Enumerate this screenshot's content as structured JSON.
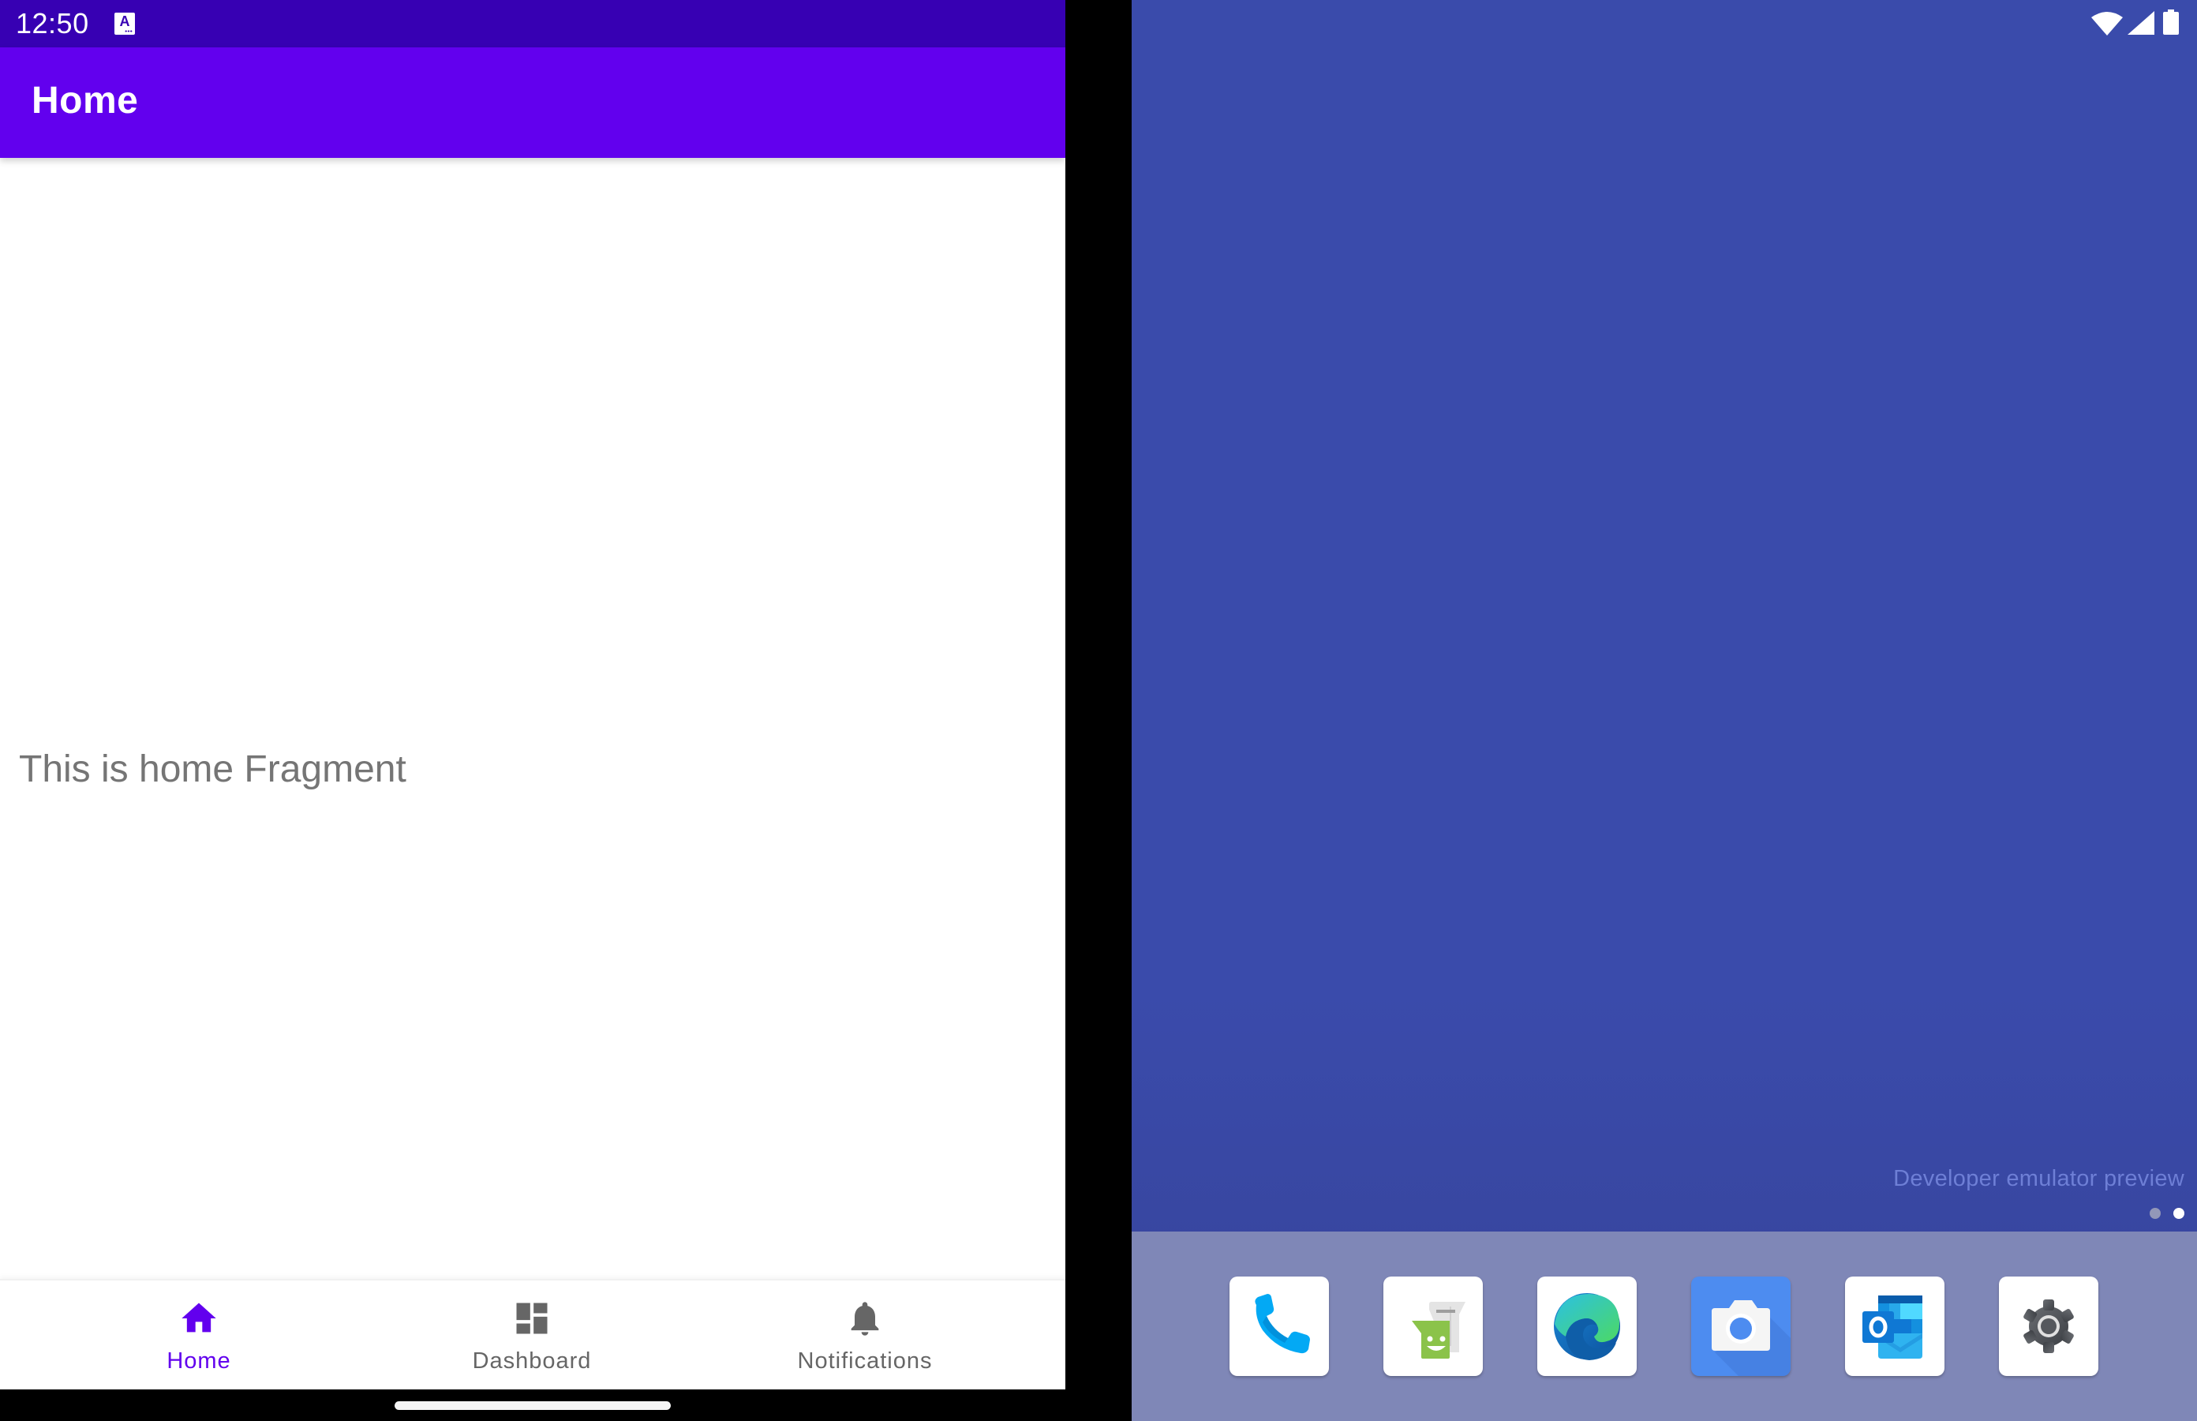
{
  "device": {
    "left_screen": {
      "status_bar": {
        "time": "12:50",
        "notification_icons": [
          "accessibility-a-icon"
        ],
        "color": "#3700b3"
      },
      "app_bar": {
        "title": "Home",
        "color": "#6200ee"
      },
      "content": {
        "text": "This is home Fragment",
        "text_color": "#757575"
      },
      "bottom_nav": {
        "active_color": "#6200ee",
        "inactive_color": "#666666",
        "items": [
          {
            "label": "Home",
            "icon": "home-icon",
            "active": true
          },
          {
            "label": "Dashboard",
            "icon": "dashboard-icon",
            "active": false
          },
          {
            "label": "Notifications",
            "icon": "bell-icon",
            "active": false
          }
        ]
      }
    },
    "right_screen": {
      "status_icons": [
        "wifi-icon",
        "cellular-signal-icon",
        "battery-icon"
      ],
      "wallpaper_color": "#3a4bab",
      "watermark": "Developer emulator preview",
      "page_indicator": {
        "pages": 2,
        "current": 2
      },
      "dock": {
        "color": "#7f87b7",
        "apps": [
          {
            "name": "Phone",
            "icon": "phone-icon"
          },
          {
            "name": "Messages",
            "icon": "messages-icon"
          },
          {
            "name": "Edge",
            "icon": "edge-browser-icon"
          },
          {
            "name": "Camera",
            "icon": "camera-icon"
          },
          {
            "name": "Outlook",
            "icon": "outlook-icon"
          },
          {
            "name": "Settings",
            "icon": "settings-gear-icon"
          }
        ]
      }
    }
  }
}
